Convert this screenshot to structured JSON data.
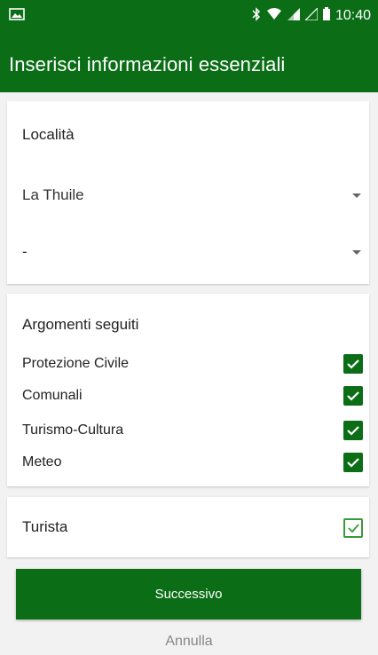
{
  "status_bar": {
    "time": "10:40",
    "icons": [
      "notification-icon",
      "bluetooth-icon",
      "wifi-icon",
      "signal-icon",
      "signal-icon",
      "battery-icon"
    ]
  },
  "app_bar": {
    "title": "Inserisci informazioni essenziali"
  },
  "location_section": {
    "title": "Località",
    "dropdowns": [
      {
        "value": "La Thuile"
      },
      {
        "value": "-"
      }
    ]
  },
  "topics_section": {
    "title": "Argomenti seguiti",
    "items": [
      {
        "label": "Protezione Civile",
        "checked": true
      },
      {
        "label": "Comunali",
        "checked": true
      },
      {
        "label": "Turismo-Cultura",
        "checked": true
      },
      {
        "label": "Meteo",
        "checked": true
      }
    ]
  },
  "tourist_section": {
    "label": "Turista",
    "checked": true
  },
  "actions": {
    "next_label": "Successivo",
    "cancel_label": "Annulla"
  },
  "colors": {
    "primary": "#0b6e17",
    "checkbox_outline": "#3a9a3a"
  }
}
